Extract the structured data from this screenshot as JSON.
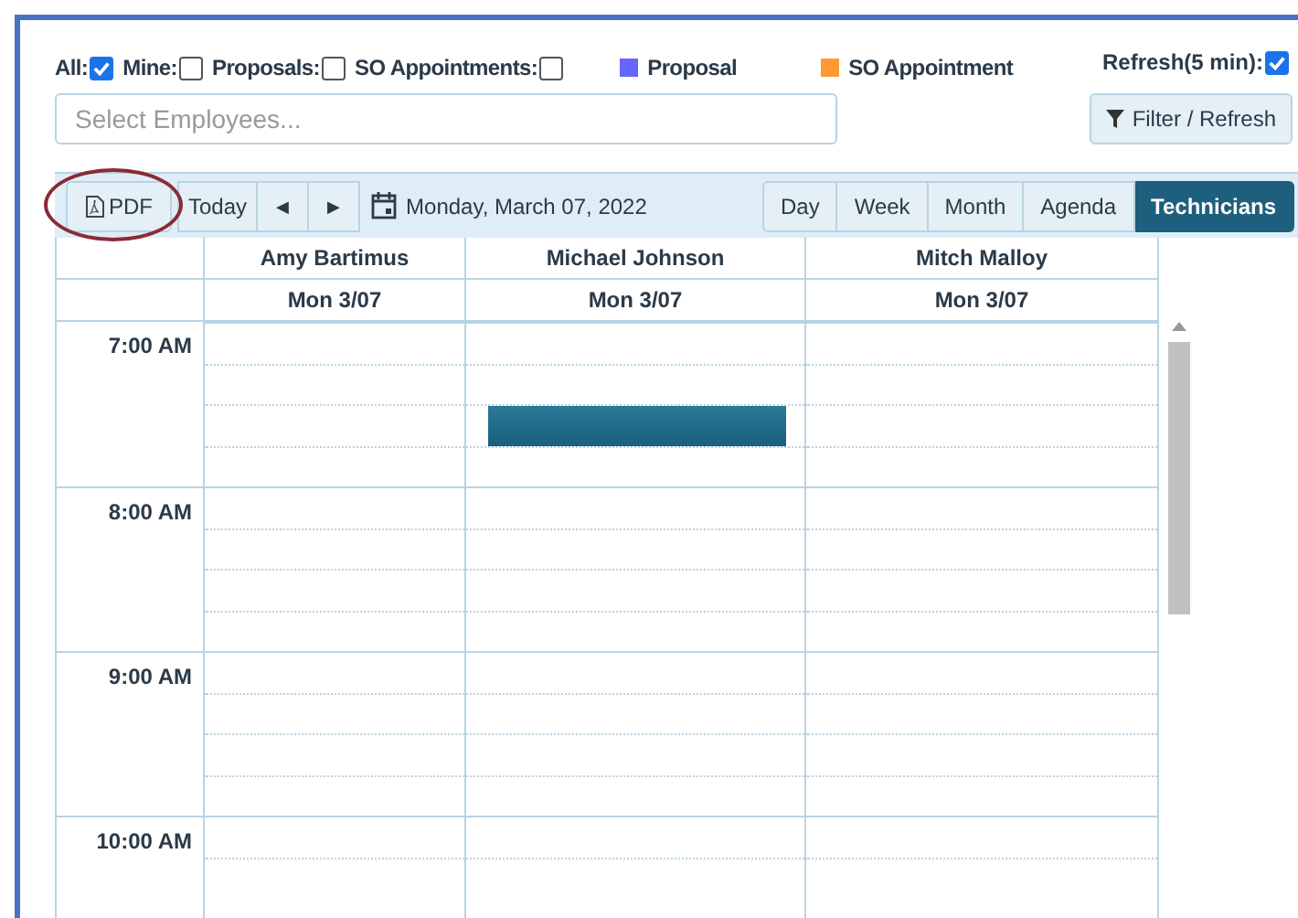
{
  "filters": [
    {
      "label": "All:",
      "checked": true
    },
    {
      "label": "Mine:",
      "checked": false
    },
    {
      "label": "Proposals:",
      "checked": false
    },
    {
      "label": "SO Appointments:",
      "checked": false
    }
  ],
  "legend": [
    {
      "label": "Proposal",
      "color": "#6666ff"
    },
    {
      "label": "SO Appointment",
      "color": "#ff9933"
    }
  ],
  "refresh": {
    "label": "Refresh(5 min):",
    "checked": true
  },
  "employee_search": {
    "placeholder": "Select Employees..."
  },
  "filter_button": "Filter / Refresh",
  "toolbar": {
    "pdf": "PDF",
    "today": "Today",
    "prev": "◀",
    "next": "▶",
    "date": "Monday, March 07, 2022"
  },
  "views": [
    {
      "label": "Day",
      "selected": false
    },
    {
      "label": "Week",
      "selected": false
    },
    {
      "label": "Month",
      "selected": false
    },
    {
      "label": "Agenda",
      "selected": false
    },
    {
      "label": "Technicians",
      "selected": true
    }
  ],
  "resources": [
    {
      "name": "Amy Bartimus",
      "date": "Mon 3/07",
      "slots": [
        {
          "booked": false
        },
        {
          "booked": false
        },
        {
          "booked": false
        },
        {
          "booked": false
        },
        {
          "booked": false
        },
        {
          "booked": false
        },
        {
          "booked": false
        },
        {
          "booked": false
        },
        {
          "booked": false
        },
        {
          "booked": false
        },
        {
          "booked": false
        },
        {
          "booked": false
        },
        {
          "booked": false
        },
        {
          "booked": false
        }
      ]
    },
    {
      "name": "Michael Johnson",
      "date": "Mon 3/07",
      "slots": [
        {
          "booked": false
        },
        {
          "booked": false
        },
        {
          "booked": true
        },
        {
          "booked": false
        },
        {
          "booked": false
        },
        {
          "booked": false
        },
        {
          "booked": false
        },
        {
          "booked": false
        },
        {
          "booked": false
        },
        {
          "booked": false
        },
        {
          "booked": false
        },
        {
          "booked": false
        },
        {
          "booked": false
        },
        {
          "booked": false
        }
      ]
    },
    {
      "name": "Mitch Malloy",
      "date": "Mon 3/07",
      "slots": [
        {
          "booked": false
        },
        {
          "booked": false
        },
        {
          "booked": false
        },
        {
          "booked": false
        },
        {
          "booked": false
        },
        {
          "booked": false
        },
        {
          "booked": false
        },
        {
          "booked": false
        },
        {
          "booked": false
        },
        {
          "booked": false
        },
        {
          "booked": false
        },
        {
          "booked": false
        },
        {
          "booked": false
        },
        {
          "booked": false
        }
      ]
    }
  ],
  "hours": [
    "7:00 AM",
    "8:00 AM",
    "9:00 AM",
    "10:00 AM"
  ]
}
